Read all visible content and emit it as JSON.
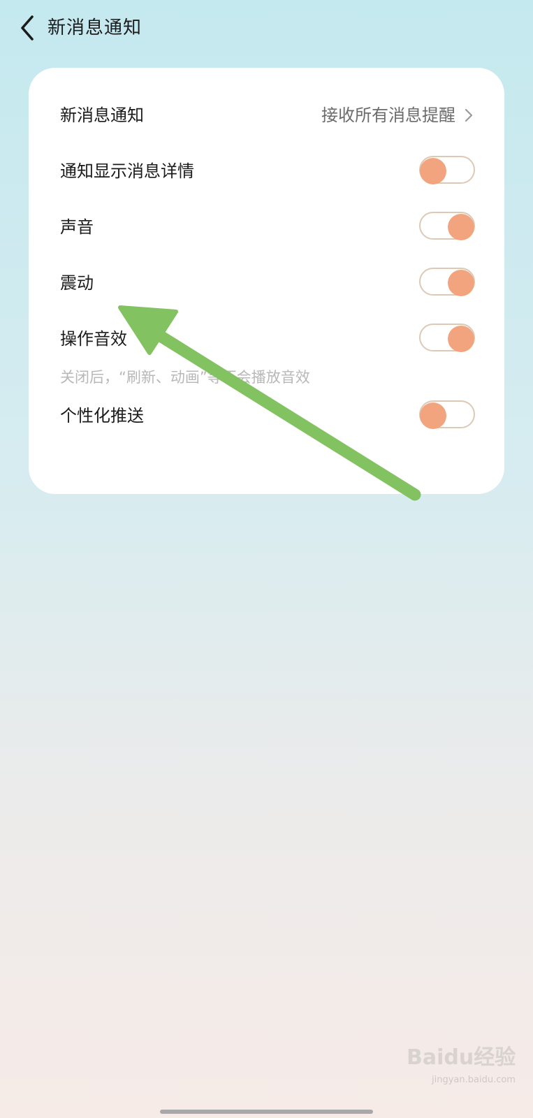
{
  "header": {
    "title": "新消息通知"
  },
  "settings": {
    "new_message": {
      "label": "新消息通知",
      "value": "接收所有消息提醒"
    },
    "show_details": {
      "label": "通知显示消息详情",
      "enabled": false
    },
    "sound": {
      "label": "声音",
      "enabled": true
    },
    "vibration": {
      "label": "震动",
      "enabled": true
    },
    "operation_sound": {
      "label": "操作音效",
      "enabled": true
    },
    "operation_sound_hint": "关闭后，“刷新、动画”等不会播放音效",
    "personalized_push": {
      "label": "个性化推送",
      "enabled": false
    }
  },
  "colors": {
    "toggle_knob": "#f2a47e",
    "toggle_border": "#dcc9b6",
    "annotation_arrow": "#83c261"
  },
  "watermark": {
    "logo": "Baidu经验",
    "url": "jingyan.baidu.com"
  }
}
